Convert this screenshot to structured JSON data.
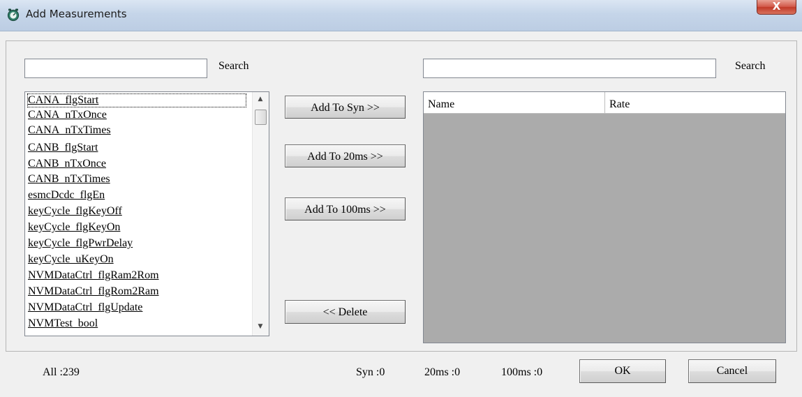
{
  "window": {
    "title": "Add Measurements",
    "close_glyph": "X",
    "icon": "app-icon"
  },
  "left_panel": {
    "search_value": "",
    "search_label": "Search",
    "items": [
      "CANA_flgStart",
      "CANA_nTxOnce",
      "CANA_nTxTimes",
      "CANB_flgStart",
      "CANB_nTxOnce",
      "CANB_nTxTimes",
      "esmcDcdc_flgEn",
      "keyCycle_flgKeyOff",
      "keyCycle_flgKeyOn",
      "keyCycle_flgPwrDelay",
      "keyCycle_uKeyOn",
      "NVMDataCtrl_flgRam2Rom",
      "NVMDataCtrl_flgRom2Ram",
      "NVMDataCtrl_flgUpdate",
      "NVMTest_bool"
    ],
    "focused_item": "CANA_flgStart",
    "scroll_up_glyph": "▲",
    "scroll_down_glyph": "▼"
  },
  "buttons": {
    "add_syn": "Add To Syn >>",
    "add_20ms": "Add To 20ms >>",
    "add_100ms": "Add To 100ms >>",
    "delete": "<< Delete",
    "ok": "OK",
    "cancel": "Cancel"
  },
  "right_panel": {
    "search_value": "",
    "search_label": "Search",
    "columns": [
      "Name",
      "Rate"
    ],
    "rows": []
  },
  "status": {
    "all": "All :239",
    "syn": "Syn :0",
    "ms20": "20ms :0",
    "ms100": "100ms :0"
  },
  "colors": {
    "window_bg": "#f0f0f0",
    "grid_empty": "#ababab",
    "close_button": "#c9463a",
    "titlebar": "#c5d5e9"
  }
}
